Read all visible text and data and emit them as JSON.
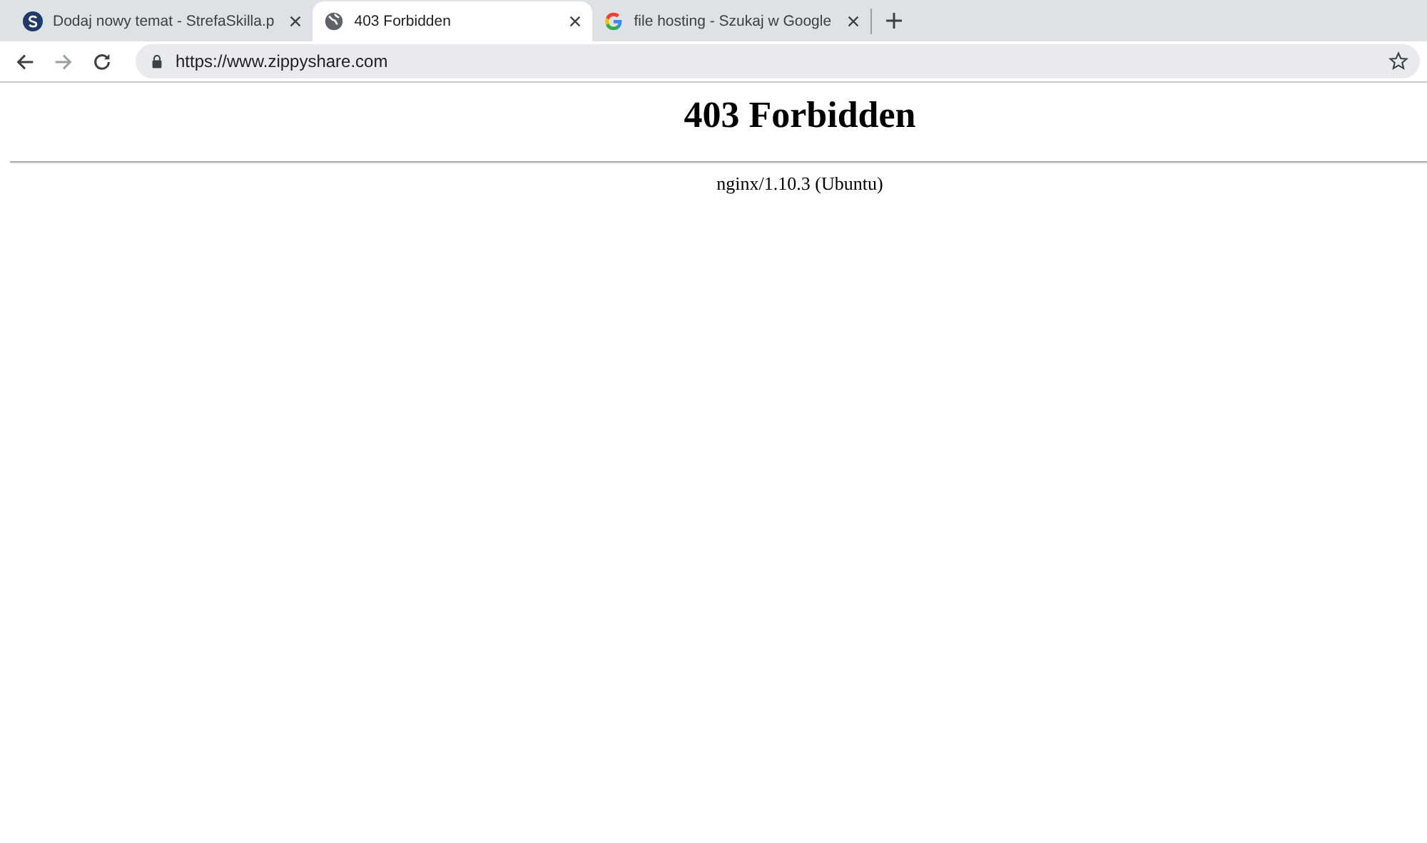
{
  "tabs": [
    {
      "kind": "s-logo",
      "title": "Dodaj nowy temat - StrefaSkilla.p",
      "selected": false
    },
    {
      "kind": "globe",
      "title": "403 Forbidden",
      "selected": true
    },
    {
      "kind": "google",
      "title": "file hosting - Szukaj w Google",
      "selected": false
    }
  ],
  "address_bar": {
    "url": "https://www.zippyshare.com"
  },
  "page": {
    "heading": "403 Forbidden",
    "server": "nginx/1.10.3 (Ubuntu)"
  }
}
